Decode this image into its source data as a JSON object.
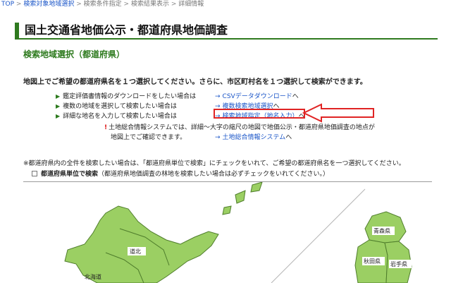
{
  "breadcrumb": {
    "top": "TOP",
    "sep": ">",
    "step1": "検索対象地域選択",
    "step2": "検索条件指定",
    "step3": "検索結果表示",
    "step4": "詳細情報"
  },
  "page": {
    "title": "国土交通省地価公示・都道府県地価調査"
  },
  "section": {
    "title": "検索地域選択（都道府県）",
    "instruction": "地図上でご希望の都道府県名を１つ選択してください。さらに、市区町村名を１つ選択して検索ができます。"
  },
  "options": [
    {
      "text": "鑑定評価書情報のダウンロードをしたい場合は",
      "arrow": "→",
      "link": "CSVデータダウンロード",
      "suffix": "へ"
    },
    {
      "text": "複数の地域を選択して検索したい場合は",
      "arrow": "→",
      "link": "複数検索地域選択",
      "suffix": "へ"
    },
    {
      "text": "詳細な地名を入力して検索したい場合は",
      "arrow": "→",
      "link": "検索地域指定（地名入力）",
      "suffix": "へ"
    }
  ],
  "note": {
    "mark": "!",
    "line1": "土地総合情報システムでは、詳細～大字の縮尺の地図で地価公示・都道府県地価調査の地点が",
    "line2": "地図上でご確認できます。",
    "arrow": "→",
    "link": "土地総合情報システム",
    "suffix": "へ"
  },
  "global_note": "※都道府県内の全件を検索したい場合は、「都道府県単位で検索」にチェックをいれて、ご希望の都道府県名を一つ選択してください。",
  "checkbox": {
    "label": "都道府県単位で検索",
    "hint": "（都道府県地価調査の林地を検索したい場合は必ずチェックをいれてください。）",
    "checked": false
  },
  "map": {
    "regions": {
      "dohoku": "道北",
      "hokkaido": "北海道",
      "aomori": "青森県",
      "akita": "秋田県",
      "iwate": "岩手県"
    },
    "colors": {
      "land": "#9bcf63",
      "border": "#4f7d2c",
      "label_bg": "#ffffff"
    }
  },
  "colors": {
    "accent": "#2d7a1d",
    "link": "#1a55c8",
    "highlight": "#e02424"
  }
}
